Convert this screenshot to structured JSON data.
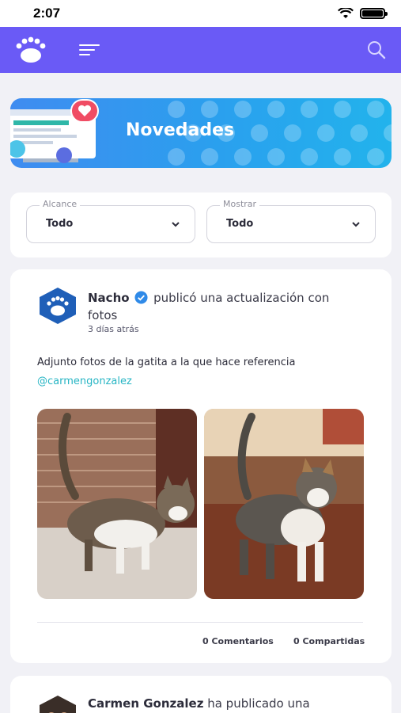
{
  "status_bar": {
    "time": "2:07"
  },
  "app_bar": {
    "logo_icon": "paw-logo-icon",
    "menu_icon": "menu-icon",
    "search_icon": "search-icon",
    "color": "#6a5af6"
  },
  "banner": {
    "title": "Novedades"
  },
  "filters": [
    {
      "label": "Alcance",
      "value": "Todo"
    },
    {
      "label": "Mostrar",
      "value": "Todo"
    }
  ],
  "posts": [
    {
      "author": "Nacho",
      "action": "publicó una actualización con fotos",
      "time": "3 días atrás",
      "text": "Adjunto fotos de la gatita a la que hace referencia",
      "mention": "@carmengonzalez",
      "photos": [
        "cat-photo-1",
        "cat-photo-2"
      ],
      "comments": "0 Comentarios",
      "shares": "0 Compartidas"
    },
    {
      "author": "Carmen Gonzalez",
      "action": "ha publicado una"
    }
  ]
}
